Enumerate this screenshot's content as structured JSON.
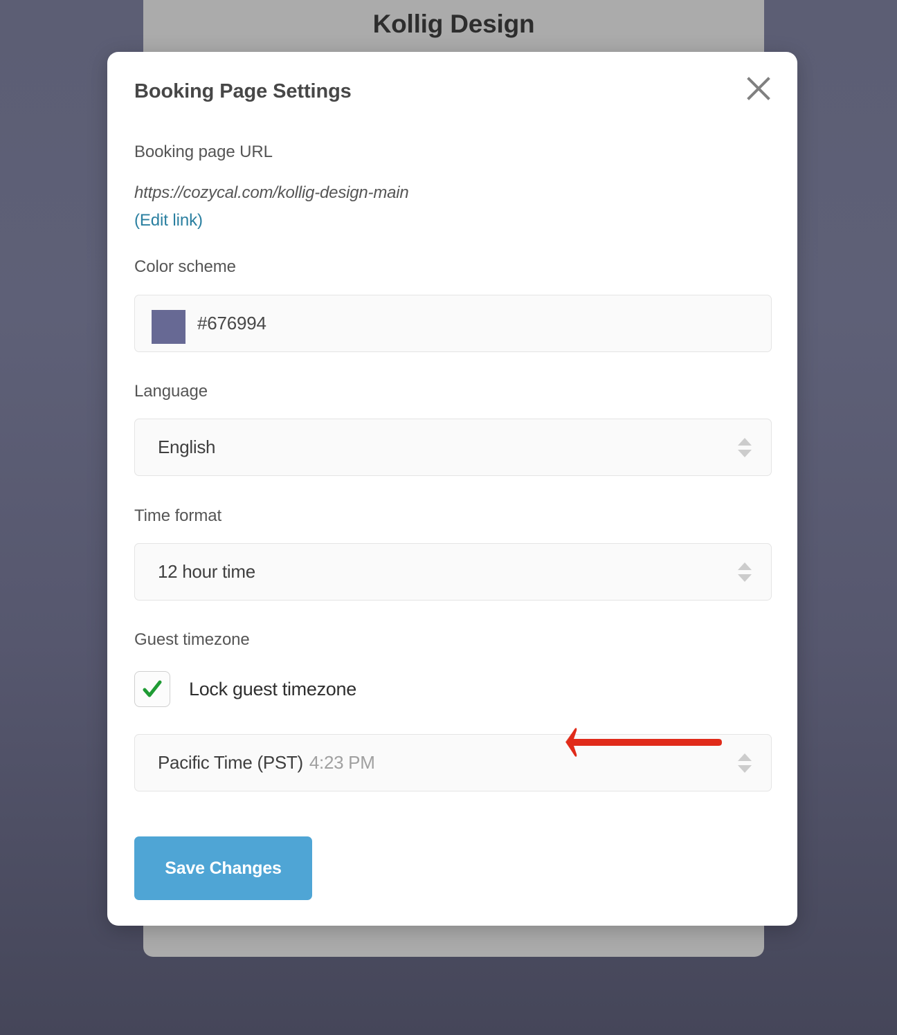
{
  "background_page": {
    "title": "Kollig Design"
  },
  "modal": {
    "title": "Booking Page Settings",
    "close_icon": "close-icon",
    "booking_url": {
      "label": "Booking page URL",
      "value": "https://cozycal.com/kollig-design-main",
      "edit_link_label": "(Edit link)"
    },
    "color_scheme": {
      "label": "Color scheme",
      "hex": "#676994",
      "swatch_color": "#676994"
    },
    "language": {
      "label": "Language",
      "selected": "English"
    },
    "time_format": {
      "label": "Time format",
      "selected": "12 hour time"
    },
    "guest_timezone": {
      "label": "Guest timezone",
      "lock_checkbox_label": "Lock guest timezone",
      "lock_checked": true,
      "check_icon": "check-icon",
      "check_color": "#1f9b34",
      "selected_zone": "Pacific Time (PST)",
      "selected_time": "4:23 PM"
    },
    "save_button_label": "Save Changes",
    "save_button_color": "#4fa5d5"
  },
  "annotation": {
    "arrow_icon": "left-arrow-annotation-icon",
    "color": "#e02b1a",
    "direction": "left"
  }
}
